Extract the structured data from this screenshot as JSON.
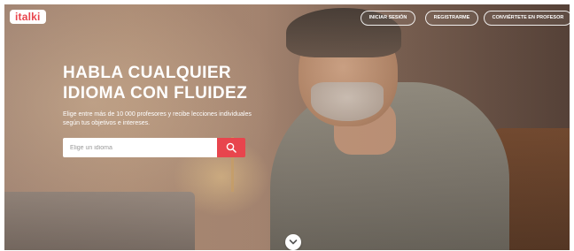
{
  "brand": {
    "logo_text": "italki",
    "accent_color": "#e8454d"
  },
  "nav": {
    "login_label": "INICIAR SESIÓN",
    "register_label": "REGISTRARME",
    "become_teacher_label": "CONVIÉRTETE EN PROFESOR"
  },
  "hero": {
    "headline_line1": "HABLA CUALQUIER",
    "headline_line2": "IDIOMA CON FLUIDEZ",
    "subtitle_line1": "Elige entre más de 10 000 profesores y recibe lecciones individuales",
    "subtitle_line2": "según tus objetivos e intereses.",
    "search": {
      "placeholder": "Elige un idioma",
      "value": "",
      "button_icon": "search-icon"
    }
  },
  "scroll": {
    "icon": "chevron-down-icon"
  }
}
